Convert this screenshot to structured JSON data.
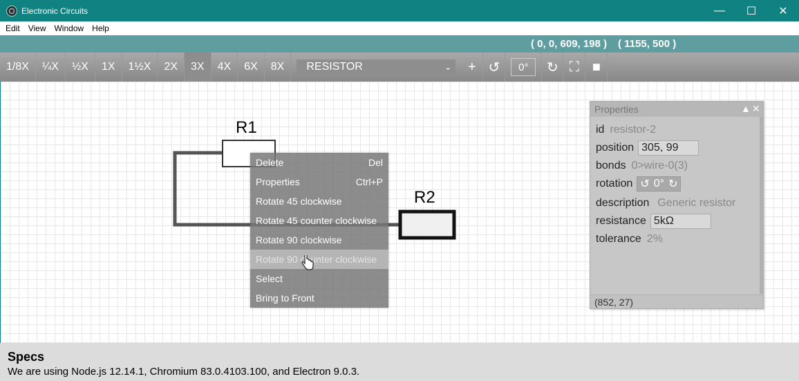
{
  "window": {
    "title": "Electronic Circuits"
  },
  "menu": [
    "Edit",
    "View",
    "Window",
    "Help"
  ],
  "coords": {
    "view": "( 0, 0, 609, 198 )",
    "size": "( 1155, 500 )"
  },
  "toolbar": {
    "zooms": [
      "1/8X",
      "¼X",
      "½X",
      "1X",
      "1½X",
      "2X",
      "3X",
      "4X",
      "6X",
      "8X"
    ],
    "active_zoom": "3X",
    "component": "RESISTOR",
    "angle": "0°"
  },
  "components": {
    "r1": "R1",
    "r2": "R2"
  },
  "context_menu": [
    {
      "label": "Delete",
      "shortcut": "Del"
    },
    {
      "label": "Properties",
      "shortcut": "Ctrl+P"
    },
    {
      "label": "Rotate 45 clockwise",
      "shortcut": ""
    },
    {
      "label": "Rotate 45 counter clockwise",
      "shortcut": ""
    },
    {
      "label": "Rotate 90 clockwise",
      "shortcut": ""
    },
    {
      "label": "Rotate 90 counter clockwise",
      "shortcut": ""
    },
    {
      "label": "Select",
      "shortcut": ""
    },
    {
      "label": "Bring to Front",
      "shortcut": ""
    }
  ],
  "properties": {
    "title": "Properties",
    "id_label": "id",
    "id": "resistor-2",
    "position_label": "position",
    "position": "305, 99",
    "bonds_label": "bonds",
    "bonds": "0>wire-0(3)",
    "rotation_label": "rotation",
    "rotation": "0°",
    "description_label": "description",
    "description": "Generic resistor",
    "resistance_label": "resistance",
    "resistance": "5kΩ",
    "tolerance_label": "tolerance",
    "tolerance": "2%",
    "footer": "(852, 27)"
  },
  "specs": {
    "title": "Specs",
    "text": "We are using Node.js 12.14.1, Chromium 83.0.4103.100, and Electron 9.0.3."
  }
}
